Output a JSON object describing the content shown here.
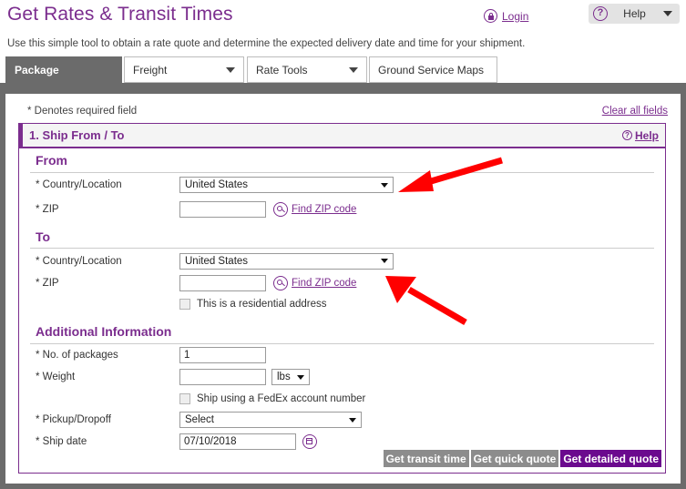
{
  "header": {
    "title": "Get Rates & Transit Times",
    "subtitle": "Use this simple tool to obtain a rate quote and determine the expected delivery date and time for your shipment.",
    "login_label": "Login",
    "login_icon": "lock-icon",
    "help_label": "Help",
    "help_icon": "question-circle-icon",
    "help_caret_icon": "chevron-down-icon"
  },
  "tabs": [
    {
      "label": "Package",
      "active": true,
      "has_caret": false
    },
    {
      "label": "Freight",
      "active": false,
      "has_caret": true
    },
    {
      "label": "Rate Tools",
      "active": false,
      "has_caret": true
    },
    {
      "label": "Ground Service Maps",
      "active": false,
      "has_caret": false
    }
  ],
  "form": {
    "required_note": "* Denotes required field",
    "clear_all_label": "Clear all fields",
    "section": {
      "title": "1. Ship From / To",
      "help_label": "Help",
      "help_icon": "question-circle-icon"
    },
    "from": {
      "group_title": "From",
      "country_label": "* Country/Location",
      "country_value": "United States",
      "zip_label": "* ZIP",
      "zip_value": "",
      "find_zip_label": "Find ZIP code",
      "find_zip_icon": "magnifier-icon"
    },
    "to": {
      "group_title": "To",
      "country_label": "* Country/Location",
      "country_value": "United States",
      "zip_label": "* ZIP",
      "zip_value": "",
      "find_zip_label": "Find ZIP code",
      "find_zip_icon": "magnifier-icon",
      "residential_label": "This is a residential address",
      "residential_checked": false
    },
    "additional": {
      "group_title": "Additional Information",
      "packages_label": "* No. of packages",
      "packages_value": "1",
      "weight_label": "* Weight",
      "weight_value": "",
      "weight_unit": "lbs",
      "account_label": "Ship using a FedEx account number",
      "account_checked": false,
      "pickup_label": "* Pickup/Dropoff",
      "pickup_value": "Select",
      "shipdate_label": "* Ship date",
      "shipdate_value": "07/10/2018",
      "calendar_icon": "calendar-icon"
    },
    "buttons": {
      "transit_label": "Get transit time",
      "quick_label": "Get quick quote",
      "detailed_label": "Get detailed quote"
    }
  },
  "annotations": {
    "arrow_color": "#ff0000",
    "arrows": [
      {
        "name": "arrow-from-country",
        "target": "from-country-select"
      },
      {
        "name": "arrow-to-zip",
        "target": "to-zip-row"
      }
    ]
  },
  "colors": {
    "brand_purple": "#7b2d8e",
    "primary_button": "#6b0a8e",
    "tab_active": "#6b6b6b"
  }
}
